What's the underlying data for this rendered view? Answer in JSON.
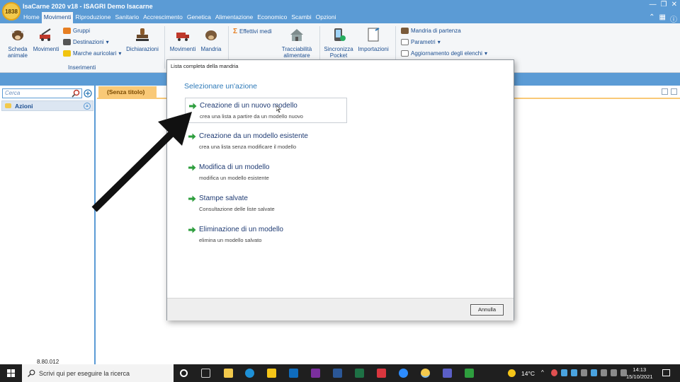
{
  "app": {
    "title": "IsaCarne 2020 v18 - ISAGRI Demo Isacarne",
    "logo_text": "1838",
    "menu": [
      "Home",
      "Movimenti",
      "Riproduzione",
      "Sanitario",
      "Accrescimento",
      "Genetica",
      "Alimentazione",
      "Economico",
      "Scambi",
      "Opzioni"
    ],
    "active_menu": "Movimenti"
  },
  "ribbon": {
    "scheda_animale": "Scheda animale",
    "movimenti": "Movimenti",
    "gruppi": "Gruppi",
    "destinazioni": "Destinazioni",
    "marche_auricolari": "Marche auricolari",
    "dichiarazioni": "Dichiarazioni",
    "inserimenti_group": "Inserimenti",
    "movimenti2": "Movimenti",
    "mandria": "Mandria",
    "effettivi_medi": "Effettivi medi",
    "tracciabilita": "Tracciabilità alimentare",
    "sincronizza": "Sincronizza Pocket",
    "importazioni": "Importazioni",
    "mandria_di_partenza": "Mandria di partenza",
    "parametri": "Parametri",
    "aggiornamento": "Aggiornamento degli elenchi"
  },
  "left": {
    "search_placeholder": "Cerca",
    "actions_label": "Azioni",
    "version": "8.80.012"
  },
  "main": {
    "tab_label": "(Senza titolo)"
  },
  "dialog": {
    "title": "Lista completa della mandria",
    "subtitle": "Selezionare un'azione",
    "options": [
      {
        "title": "Creazione di un nuovo modello",
        "desc": "crea una lista a partire da un modello nuovo"
      },
      {
        "title": "Creazione da un modello esistente",
        "desc": "crea una lista senza modificare il modello"
      },
      {
        "title": "Modifica di un modello",
        "desc": "modifica un modello esistente"
      },
      {
        "title": "Stampe salvate",
        "desc": "Consultazione delle liste salvate"
      },
      {
        "title": "Eliminazione di un modello",
        "desc": "elimina un modello salvato"
      }
    ],
    "cancel_label": "Annulla"
  },
  "taskbar": {
    "search_placeholder": "Scrivi qui per eseguire la ricerca",
    "temperature": "14°C",
    "time": "14:13",
    "date": "15/10/2021"
  },
  "colors": {
    "accent": "#5b9bd5",
    "tab": "#f9c977",
    "option_title": "#1f3b73",
    "arrow_green": "#2e9e3e"
  }
}
